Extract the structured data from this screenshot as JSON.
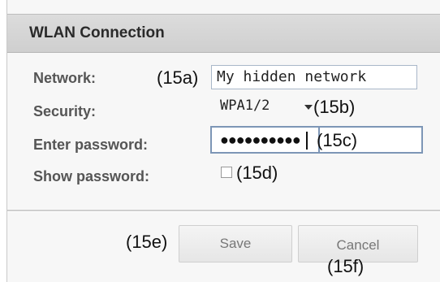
{
  "dialog": {
    "title": "WLAN Connection"
  },
  "network": {
    "label": "Network:",
    "value": "My hidden network",
    "callout": "(15a)"
  },
  "security": {
    "label": "Security:",
    "selected": "WPA1/2",
    "callout": "(15b)"
  },
  "password": {
    "label": "Enter password:",
    "masked": "●●●●●●●●●●",
    "callout": "(15c)"
  },
  "show_password": {
    "label": "Show password:",
    "checked": false,
    "callout": "(15d)"
  },
  "buttons": {
    "save_label": "Save",
    "save_callout": "(15e)",
    "cancel_label": "Cancel",
    "cancel_callout": "(15f)"
  },
  "icons": {
    "security_dropdown": "chevron-down-icon",
    "show_password_checkbox": "checkbox-unchecked-icon"
  },
  "colors": {
    "title_bar": "#d4d4d4",
    "field_border": "#a9b7c9",
    "label_text": "#555555"
  }
}
